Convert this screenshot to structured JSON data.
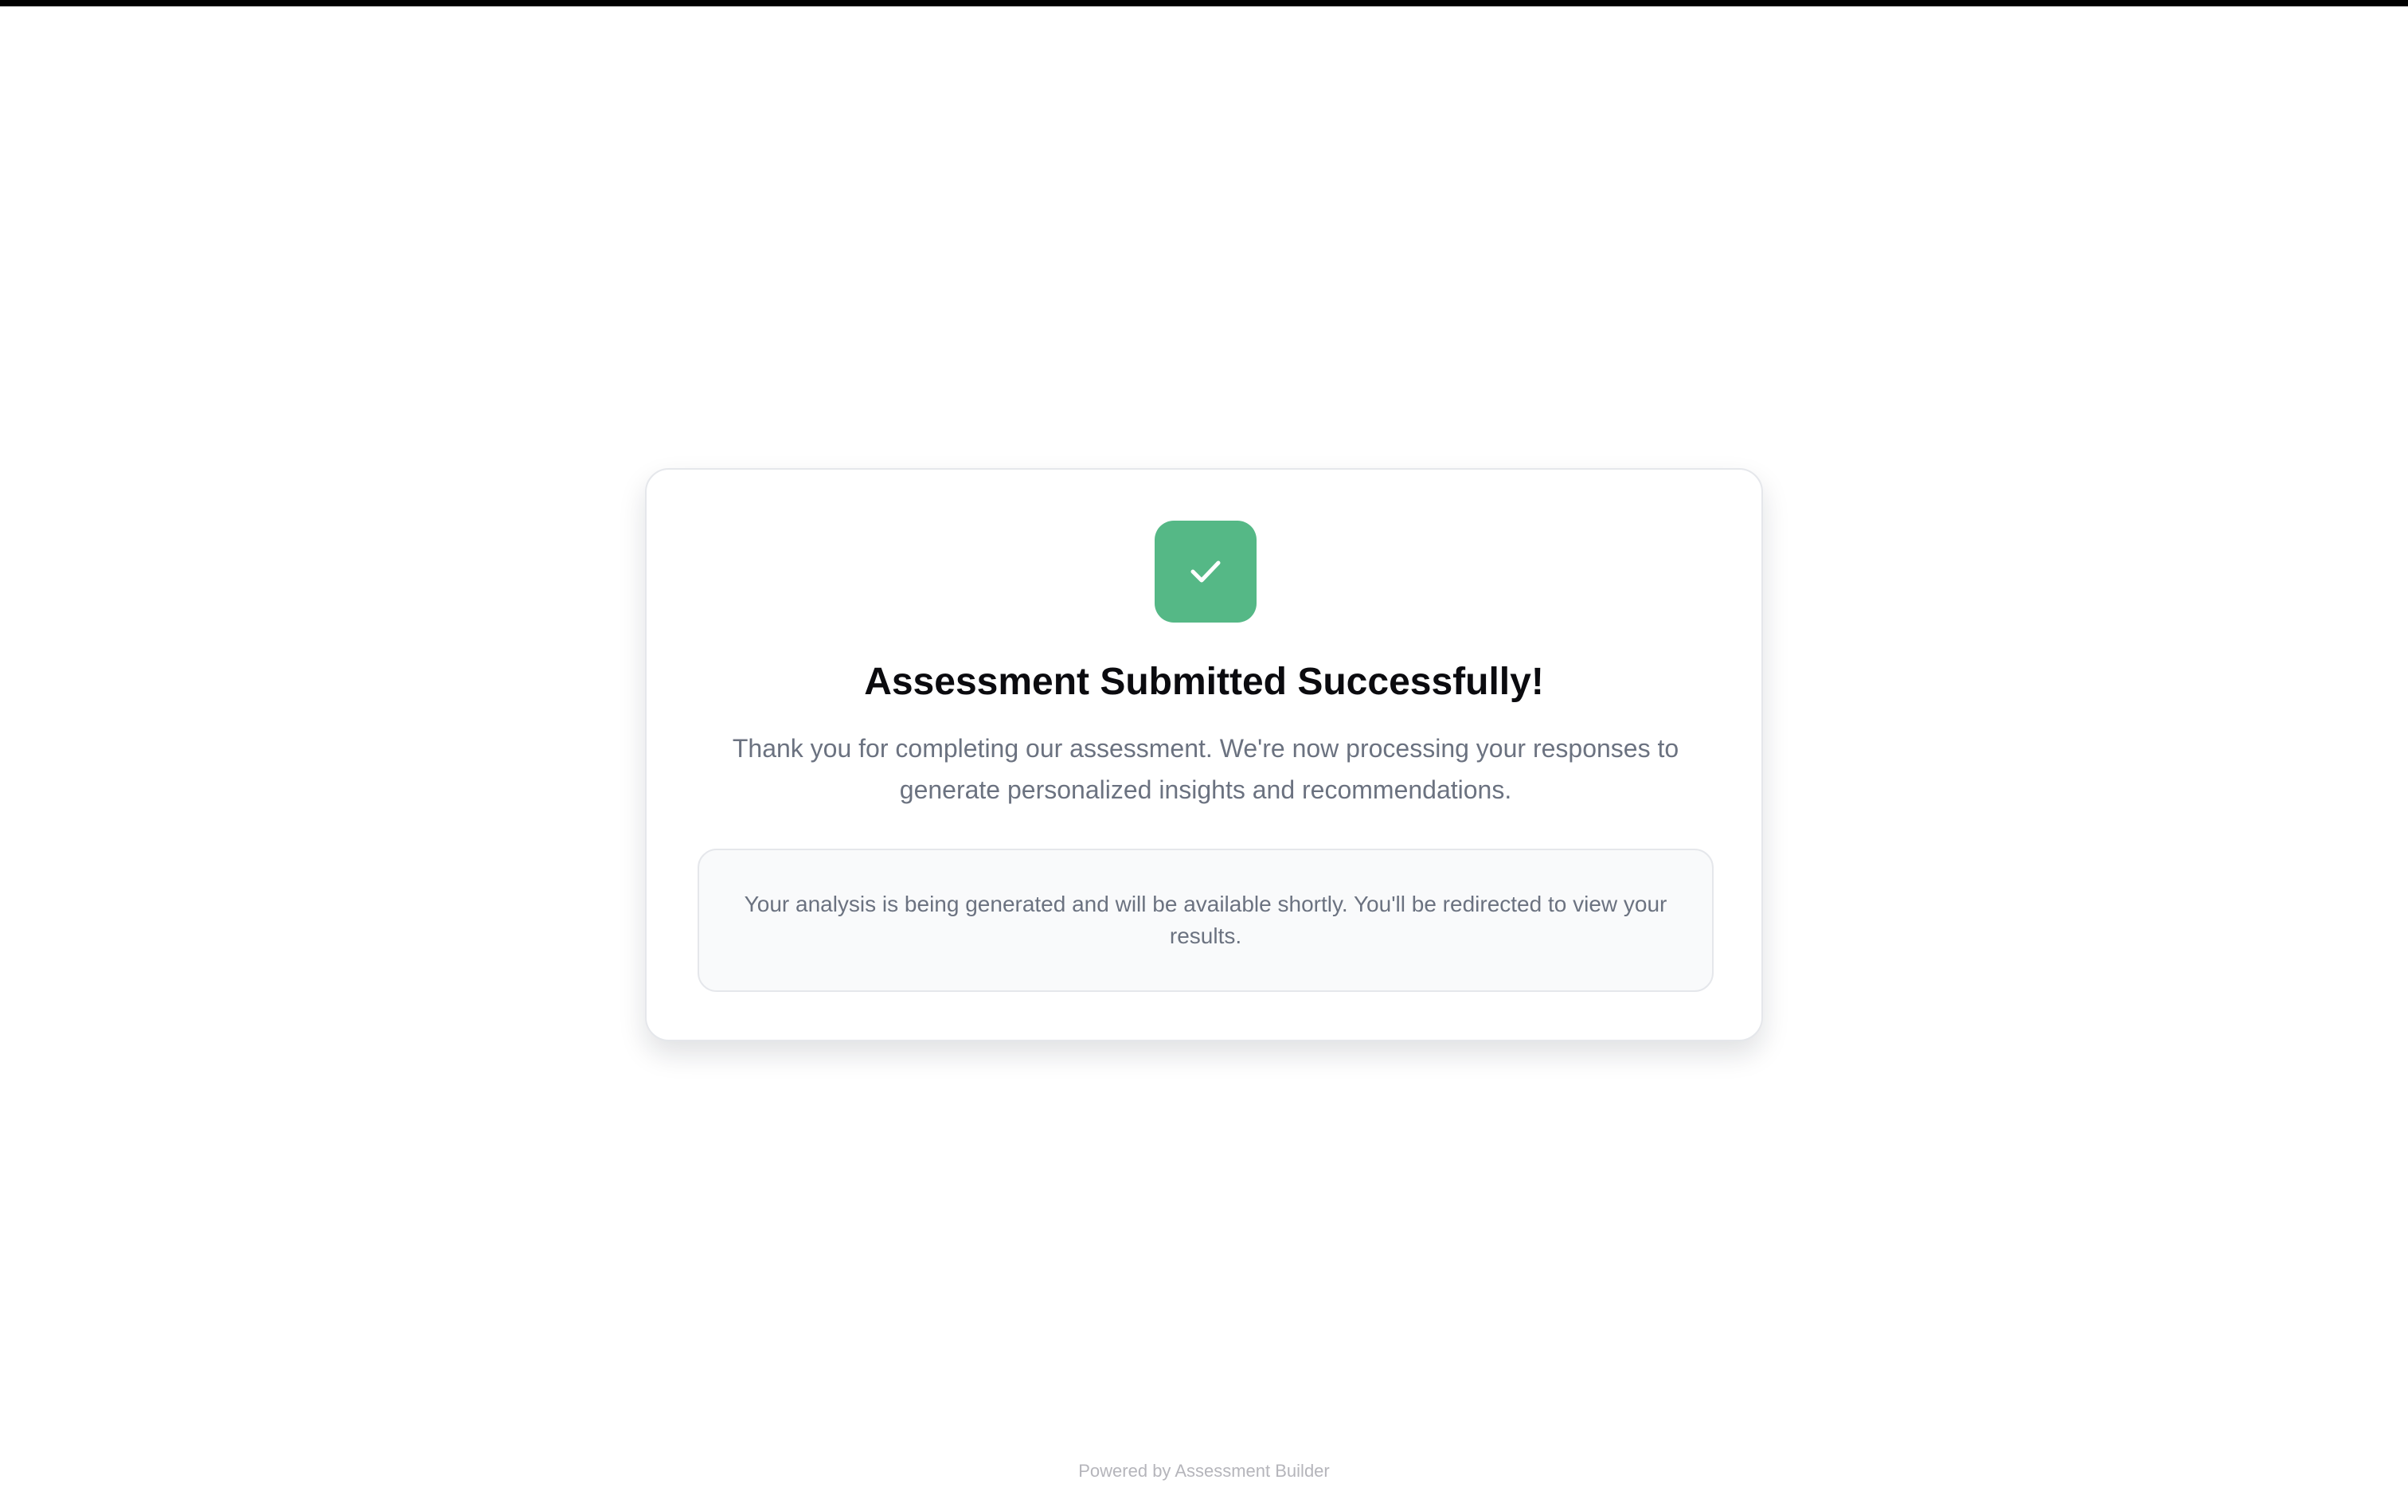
{
  "page": {
    "background_color": "#ffffff",
    "top_bar_color": "#000000"
  },
  "status_card": {
    "icon": "checkmark-icon",
    "accent_color": "#55b886",
    "title": "Assessment Submitted Successfully!",
    "message": "Thank you for completing our assessment. We're now processing your responses to generate personalized insights and recommendations.",
    "info": "Your analysis is being generated and will be available shortly. You'll be redirected to view your results."
  },
  "footer": {
    "text": "Powered by Assessment Builder"
  }
}
